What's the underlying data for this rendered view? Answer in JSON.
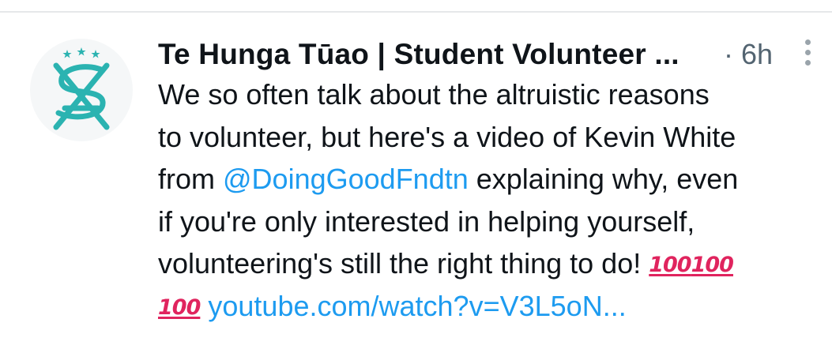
{
  "tweet": {
    "display_name": "Te Hunga Tūao | Student Volunteer ...",
    "separator": "·",
    "timestamp": "6h",
    "lines": [
      "We so often talk about the altruistic reasons",
      "to volunteer, but here's a video of Kevin White"
    ],
    "line3_pre": "from ",
    "mention": "@DoingGoodFndtn",
    "line3_post": " explaining why, even",
    "line4": "if you're only interested in helping yourself,",
    "line5": "volunteering's still the right thing to do! ",
    "emoji_hundred": "100",
    "link": "youtube.com/watch?v=V3L5oN..."
  },
  "icons": {
    "avatar": "student-volunteer-army-logo",
    "more": "more-vertical-icon"
  },
  "colors": {
    "text": "#0f1419",
    "muted": "#536471",
    "link": "#1d9bf0",
    "logo_teal": "#2bb3b1",
    "emoji_red": "#e0245e"
  }
}
